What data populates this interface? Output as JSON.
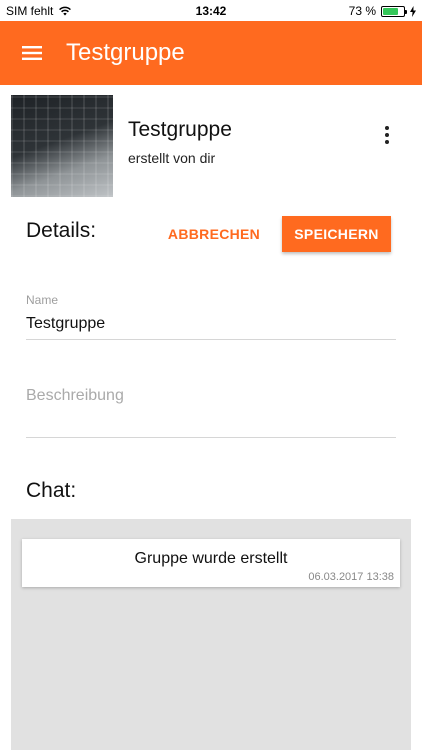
{
  "status_bar": {
    "carrier": "SIM fehlt",
    "time": "13:42",
    "battery": "73 %",
    "battery_level": 0.73
  },
  "app_bar": {
    "title": "Testgruppe",
    "menu_icon": "hamburger-menu-icon"
  },
  "group": {
    "name": "Testgruppe",
    "creator": "erstellt von dir",
    "image": "keyboard-photo",
    "more_icon": "more-vertical-icon"
  },
  "details": {
    "heading": "Details:",
    "cancel_label": "ABBRECHEN",
    "save_label": "SPEICHERN",
    "name_label": "Name",
    "name_value": "Testgruppe",
    "description_placeholder": "Beschreibung"
  },
  "chat": {
    "heading": "Chat:",
    "messages": [
      {
        "text": "Gruppe wurde erstellt",
        "timestamp": "06.03.2017 13:38"
      }
    ]
  },
  "colors": {
    "accent": "#ff6a1f",
    "chat_background": "#e1e1e1"
  }
}
